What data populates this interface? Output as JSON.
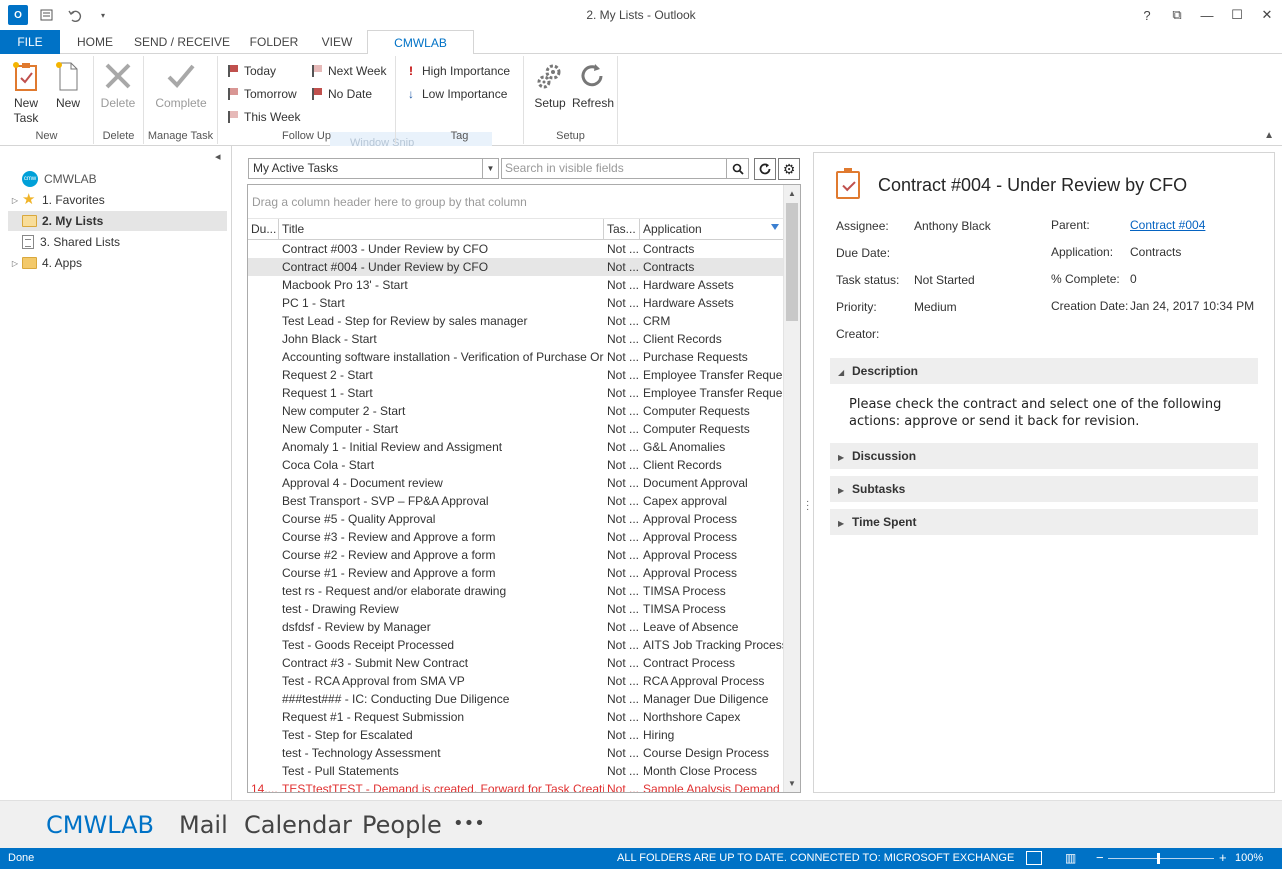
{
  "window": {
    "title": "2. My Lists - Outlook",
    "logo_text": "O",
    "help": "?",
    "restore_ribbon": "⧉",
    "minimize": "—",
    "maximize": "☐",
    "close": "✕"
  },
  "tabs": [
    {
      "label": "FILE"
    },
    {
      "label": "HOME"
    },
    {
      "label": "SEND / RECEIVE"
    },
    {
      "label": "FOLDER"
    },
    {
      "label": "VIEW"
    },
    {
      "label": "CMWLAB"
    }
  ],
  "ribbon": {
    "new_group": {
      "label": "New",
      "new_task": "New Task",
      "new": "New"
    },
    "delete_group": {
      "label": "Delete",
      "delete": "Delete"
    },
    "manage_group": {
      "label": "Manage Task",
      "complete": "Complete"
    },
    "followup_group": {
      "label": "Follow Up",
      "today": "Today",
      "tomorrow": "Tomorrow",
      "this_week": "This Week",
      "next_week": "Next Week",
      "no_date": "No Date"
    },
    "tag_group": {
      "label": "Tag",
      "high": "High Importance",
      "low": "Low Importance"
    },
    "setup_group": {
      "label": "Setup",
      "setup": "Setup",
      "refresh": "Refresh"
    },
    "ghost_text": "Window Snip"
  },
  "nav": {
    "account": "CMWLAB",
    "account_badge": "cmw",
    "items": [
      {
        "label": "1. Favorites"
      },
      {
        "label": "2. My Lists"
      },
      {
        "label": "3. Shared Lists"
      },
      {
        "label": "4. Apps"
      }
    ]
  },
  "list": {
    "view_select": "My Active Tasks",
    "search_placeholder": "Search in visible fields",
    "group_hint": "Drag a column header here to group by that column",
    "columns": [
      "Du...",
      "Title",
      "Tas...",
      "Application"
    ],
    "rows": [
      {
        "due": "",
        "title": "Contract #003 - Under Review by CFO",
        "status": "Not ...",
        "app": "Contracts"
      },
      {
        "due": "",
        "title": "Contract #004 - Under Review by CFO",
        "status": "Not ...",
        "app": "Contracts"
      },
      {
        "due": "",
        "title": "Macbook Pro 13' - Start",
        "status": "Not ...",
        "app": "Hardware Assets"
      },
      {
        "due": "",
        "title": "PC 1 - Start",
        "status": "Not ...",
        "app": "Hardware Assets"
      },
      {
        "due": "",
        "title": "Test Lead - Step for Review by sales manager",
        "status": "Not ...",
        "app": "CRM"
      },
      {
        "due": "",
        "title": "John Black - Start",
        "status": "Not ...",
        "app": "Client Records"
      },
      {
        "due": "",
        "title": "Accounting software installation - Verification of Purchase Order",
        "status": "Not ...",
        "app": "Purchase Requests"
      },
      {
        "due": "",
        "title": "Request 2 - Start",
        "status": "Not ...",
        "app": "Employee Transfer Reque..."
      },
      {
        "due": "",
        "title": "Request 1 - Start",
        "status": "Not ...",
        "app": "Employee Transfer Reque..."
      },
      {
        "due": "",
        "title": "New computer 2 - Start",
        "status": "Not ...",
        "app": "Computer Requests"
      },
      {
        "due": "",
        "title": "New Computer - Start",
        "status": "Not ...",
        "app": "Computer Requests"
      },
      {
        "due": "",
        "title": "Anomaly 1 - Initial Review and Assigment",
        "status": "Not ...",
        "app": "G&L Anomalies"
      },
      {
        "due": "",
        "title": "Coca Cola - Start",
        "status": "Not ...",
        "app": "Client Records"
      },
      {
        "due": "",
        "title": "Approval 4 - Document review",
        "status": "Not ...",
        "app": "Document Approval"
      },
      {
        "due": "",
        "title": "Best Transport - SVP – FP&A Approval",
        "status": "Not ...",
        "app": "Capex approval"
      },
      {
        "due": "",
        "title": "Course #5 - Quality Approval",
        "status": "Not ...",
        "app": "Approval Process"
      },
      {
        "due": "",
        "title": "Course #3 - Review and Approve a form",
        "status": "Not ...",
        "app": "Approval Process"
      },
      {
        "due": "",
        "title": "Course #2 - Review and Approve a form",
        "status": "Not ...",
        "app": "Approval Process"
      },
      {
        "due": "",
        "title": "Course #1 - Review and Approve a form",
        "status": "Not ...",
        "app": "Approval Process"
      },
      {
        "due": "",
        "title": "test rs - Request and/or elaborate drawing",
        "status": "Not ...",
        "app": "TIMSA Process"
      },
      {
        "due": "",
        "title": "test - Drawing Review",
        "status": "Not ...",
        "app": "TIMSA Process"
      },
      {
        "due": "",
        "title": "dsfdsf - Review by Manager",
        "status": "Not ...",
        "app": "Leave of Absence"
      },
      {
        "due": "",
        "title": "Test - Goods Receipt Processed",
        "status": "Not ...",
        "app": "AITS Job Tracking Process"
      },
      {
        "due": "",
        "title": "Contract #3 - Submit New Contract",
        "status": "Not ...",
        "app": "Contract Process"
      },
      {
        "due": "",
        "title": "Test - RCA Approval from SMA VP",
        "status": "Not ...",
        "app": "RCA Approval Process"
      },
      {
        "due": "",
        "title": "###test### - IC: Conducting Due Diligence",
        "status": "Not ...",
        "app": "Manager Due Diligence"
      },
      {
        "due": "",
        "title": "Request #1 - Request Submission",
        "status": "Not ...",
        "app": "Northshore Capex"
      },
      {
        "due": "",
        "title": "Test - Step for Escalated",
        "status": "Not ...",
        "app": "Hiring"
      },
      {
        "due": "",
        "title": "test - Technology Assessment",
        "status": "Not ...",
        "app": "Course Design Process"
      },
      {
        "due": "",
        "title": "Test - Pull Statements",
        "status": "Not ...",
        "app": "Month Close Process"
      },
      {
        "due": "14....",
        "title": "TESTtestTEST - Demand is created. Forward for Task Creation",
        "status": "Not ...",
        "app": "Sample Analysis Demand"
      }
    ]
  },
  "detail": {
    "title": "Contract #004 - Under Review by CFO",
    "fields": {
      "assignee_label": "Assignee:",
      "assignee": "Anthony Black",
      "due_label": "Due Date:",
      "status_label": "Task status:",
      "status": "Not Started",
      "priority_label": "Priority:",
      "priority": "Medium",
      "creator_label": "Creator:",
      "parent_label": "Parent:",
      "parent": "Contract #004",
      "app_label": "Application:",
      "app": "Contracts",
      "complete_label": "% Complete:",
      "complete": "0",
      "created_label": "Creation Date:",
      "created": "Jan 24, 2017 10:34 PM"
    },
    "sections": [
      "Description",
      "Discussion",
      "Subtasks",
      "Time Spent"
    ],
    "description": "Please check the contract and select one of the following actions: approve or send it back for revision."
  },
  "bottomnav": [
    "CMWLAB",
    "Mail",
    "Calendar",
    "People",
    "•••"
  ],
  "status": {
    "left": "Done",
    "folders": "ALL FOLDERS ARE UP TO DATE.",
    "connection": "CONNECTED TO: MICROSOFT EXCHANGE",
    "zoom": "100%",
    "zoom_out": "−",
    "zoom_in": "+"
  },
  "colors": {
    "accent": "#0072c6",
    "overdue": "#e03030",
    "link": "#0563c1"
  }
}
